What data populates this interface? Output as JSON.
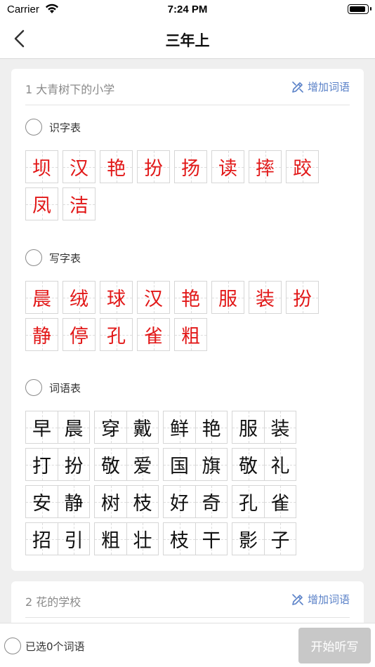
{
  "status_bar": {
    "carrier": "Carrier",
    "time": "7:24 PM"
  },
  "nav": {
    "title": "三年上"
  },
  "lessons": [
    {
      "title": "1 大青树下的小学",
      "add_label": "增加词语",
      "sections": [
        {
          "label": "识字表",
          "chars": [
            "坝",
            "汉",
            "艳",
            "扮",
            "扬",
            "读",
            "摔",
            "跤",
            "凤",
            "洁"
          ]
        },
        {
          "label": "写字表",
          "chars": [
            "晨",
            "绒",
            "球",
            "汉",
            "艳",
            "服",
            "装",
            "扮",
            "静",
            "停",
            "孔",
            "雀",
            "粗"
          ]
        },
        {
          "label": "词语表",
          "words": [
            [
              "早",
              "晨"
            ],
            [
              "穿",
              "戴"
            ],
            [
              "鲜",
              "艳"
            ],
            [
              "服",
              "装"
            ],
            [
              "打",
              "扮"
            ],
            [
              "敬",
              "爱"
            ],
            [
              "国",
              "旗"
            ],
            [
              "敬",
              "礼"
            ],
            [
              "安",
              "静"
            ],
            [
              "树",
              "枝"
            ],
            [
              "好",
              "奇"
            ],
            [
              "孔",
              "雀"
            ],
            [
              "招",
              "引"
            ],
            [
              "粗",
              "壮"
            ],
            [
              "枝",
              "干"
            ],
            [
              "影",
              "子"
            ]
          ]
        }
      ]
    },
    {
      "title": "2 花的学校",
      "add_label": "增加词语"
    }
  ],
  "bottom": {
    "selected_text": "已选0个词语",
    "start_label": "开始听写"
  }
}
